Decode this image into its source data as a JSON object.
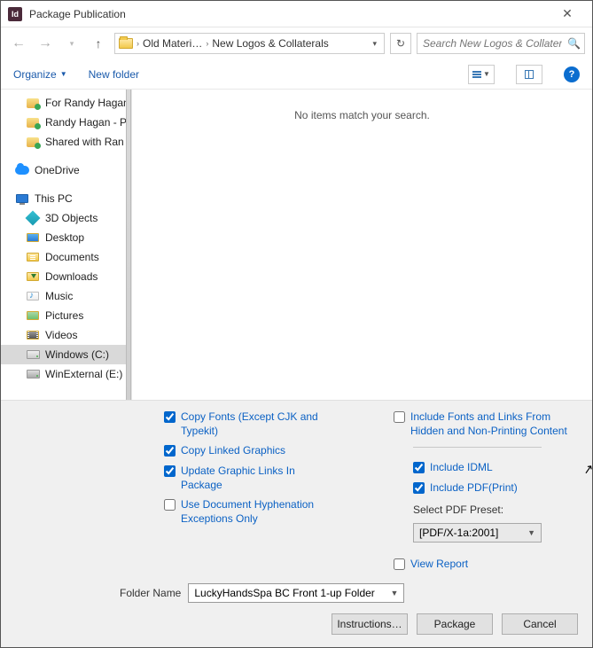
{
  "window": {
    "title": "Package Publication"
  },
  "nav": {
    "breadcrumb": [
      "Old Materi…",
      "New Logos & Collaterals"
    ],
    "search_placeholder": "Search New Logos & Collater…"
  },
  "toolbar": {
    "organize": "Organize",
    "newfolder": "New folder"
  },
  "tree": {
    "recent": [
      "For Randy Hagan",
      "Randy Hagan - P",
      "Shared with Ran"
    ],
    "onedrive": "OneDrive",
    "thispc": "This PC",
    "items": [
      "3D Objects",
      "Desktop",
      "Documents",
      "Downloads",
      "Music",
      "Pictures",
      "Videos",
      "Windows (C:)",
      "WinExternal (E:)"
    ],
    "selected_index": 7
  },
  "main": {
    "empty": "No items match your search."
  },
  "options": {
    "copy_fonts": "Copy Fonts (Except CJK and Typekit)",
    "copy_linked": "Copy Linked Graphics",
    "update_links": "Update Graphic Links In Package",
    "hyphenation": "Use Document Hyphenation Exceptions Only",
    "hidden": "Include Fonts and Links From Hidden and Non-Printing Content",
    "idml": "Include IDML",
    "pdf": "Include PDF(Print)",
    "preset_label": "Select PDF Preset:",
    "preset_value": "[PDF/X-1a:2001]",
    "view_report": "View Report"
  },
  "folder": {
    "label": "Folder Name",
    "value": "LuckyHandsSpa BC Front 1-up Folder"
  },
  "buttons": {
    "instructions": "Instructions…",
    "package": "Package",
    "cancel": "Cancel"
  }
}
